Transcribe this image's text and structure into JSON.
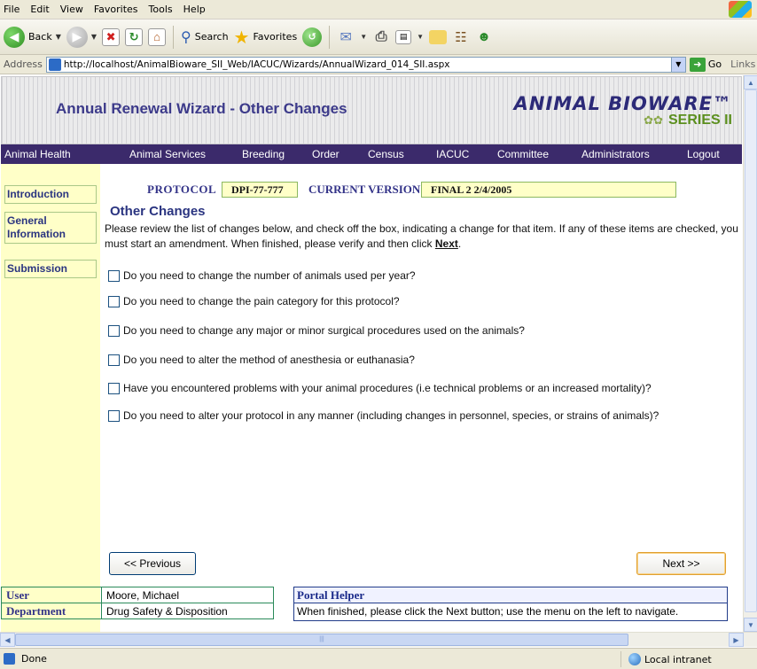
{
  "browser": {
    "menu": [
      "File",
      "Edit",
      "View",
      "Favorites",
      "Tools",
      "Help"
    ],
    "toolbar": {
      "back": "Back",
      "search": "Search",
      "favorites": "Favorites"
    },
    "address_label": "Address",
    "url": "http://localhost/AnimalBioware_SII_Web/IACUC/Wizards/AnnualWizard_014_SII.aspx",
    "go": "Go",
    "links": "Links",
    "status": "Done",
    "zone": "Local intranet"
  },
  "header": {
    "title": "Annual Renewal Wizard - Other Changes",
    "brand_line1": "ANIMAL BIOWARE™",
    "brand_line2": "SERIES II"
  },
  "nav": [
    "Animal Health",
    "Animal Services",
    "Breeding",
    "Order",
    "Census",
    "IACUC",
    "Committee",
    "Administrators",
    "Logout"
  ],
  "sidebar": [
    {
      "label": "Introduction"
    },
    {
      "label": "General Information"
    },
    {
      "label": "Submission"
    }
  ],
  "protocol": {
    "protocol_label": "PROTOCOL",
    "protocol_value": "DPI-77-777",
    "version_label": "CURRENT VERSION",
    "version_value": "FINAL 2 2/4/2005"
  },
  "content": {
    "section_title": "Other Changes",
    "instructions": "Please review the list of changes below, and check off the box, indicating a change for that item.  If any of these items are checked, you must start an amendment.  When finished, please verify and then click ",
    "next_link": "Next",
    "instructions_end": ".",
    "questions": [
      "Do you need to change the number of animals used per year?",
      "Do you need to change the pain category for this protocol?",
      "Do you need to change any major or minor surgical procedures used on the animals?",
      "Do you need to alter the method of anesthesia or euthanasia?",
      "Have you encountered problems with your animal procedures (i.e technical problems or an increased mortality)?",
      "Do you need to alter your protocol in any manner (including changes in personnel, species, or strains of animals)?"
    ],
    "prev_button": "<< Previous",
    "next_button": "Next >>"
  },
  "footer": {
    "user_label": "User",
    "user_value": "Moore, Michael",
    "dept_label": "Department",
    "dept_value": "Drug Safety & Disposition",
    "helper_title": "Portal Helper",
    "helper_text": "When finished, please click the Next button; use the menu on the left to navigate."
  }
}
